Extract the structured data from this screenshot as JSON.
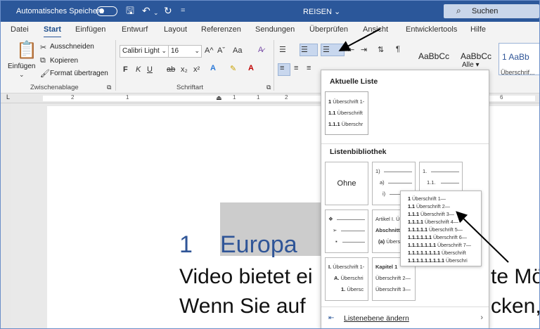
{
  "titlebar": {
    "autosave_label": "Automatisches Speichern",
    "doc_title": "REISEN",
    "title_chevron": "⌄",
    "search_label": "Suchen"
  },
  "tabs": [
    "Datei",
    "Start",
    "Einfügen",
    "Entwurf",
    "Layout",
    "Referenzen",
    "Sendungen",
    "Überprüfen",
    "Ansicht",
    "Entwicklertools",
    "Hilfe"
  ],
  "clipboard": {
    "paste": "Einfügen",
    "cut": "Ausschneiden",
    "copy": "Kopieren",
    "format_painter": "Format übertragen",
    "group_label": "Zwischenablage"
  },
  "font": {
    "name": "Calibri Light",
    "size": "16",
    "group_label": "Schriftart",
    "bold": "F",
    "italic": "K",
    "underline": "U",
    "strike": "ab",
    "sub": "x₂",
    "sup": "x²",
    "grow": "A^",
    "shrink": "Aˇ",
    "case": "Aa"
  },
  "styles": {
    "items": [
      "AaBbCc",
      "AaBbCc",
      "1 AaBb"
    ],
    "all_label": "Alle",
    "third_caption": "Überschrif..."
  },
  "document": {
    "heading_number": "1",
    "heading_text": "Europa",
    "line1_start": "Video bietet ei",
    "line1_end": "te Mö",
    "line2_start": "Wenn Sie auf",
    "line2_end": "cken,"
  },
  "ruler": {
    "numbers": [
      "2",
      "1",
      "1",
      "1",
      "2",
      "6"
    ]
  },
  "dropdown": {
    "current_list_header": "Aktuelle Liste",
    "current_list": [
      {
        "num": "1",
        "text": "Überschrift 1-"
      },
      {
        "num": "1.1",
        "text": "Überschrift"
      },
      {
        "num": "1.1.1",
        "text": "Überschr"
      }
    ],
    "library_header": "Listenbibliothek",
    "none_label": "Ohne",
    "tile2": {
      "l1": "1)",
      "l2": "a)",
      "l3": "i)"
    },
    "tile3": {
      "l1": "1.",
      "l2": "1.1."
    },
    "tile4": {
      "l1": "❖",
      "l2": "➢",
      "l3": "▪"
    },
    "tile5": {
      "l1": "Artikel I. Ü",
      "l2": "Abschnitt",
      "l3a": "(a)",
      "l3b": "Übers"
    },
    "tile7": {
      "l1a": "I.",
      "l1b": "Überschrift 1-",
      "l2a": "A.",
      "l2b": "Überschri",
      "l3a": "1.",
      "l3b": "Übersc"
    },
    "tile8": {
      "l1": "Kapitel 1",
      "l2": "Überschrift 2—",
      "l3": "Überschrift 3—"
    },
    "footer_label": "Listenebene ändern"
  },
  "preview": {
    "lines": [
      {
        "num": "1",
        "text": "Überschrift 1—"
      },
      {
        "num": "1.1",
        "text": "Überschrift 2—"
      },
      {
        "num": "1.1.1",
        "text": "Überschrift 3—"
      },
      {
        "num": "1.1.1.1",
        "text": "Überschrift 4—"
      },
      {
        "num": "1.1.1.1.1",
        "text": "Überschrift 5—"
      },
      {
        "num": "1.1.1.1.1.1",
        "text": "Überschrift 6—"
      },
      {
        "num": "1.1.1.1.1.1.1",
        "text": "Überschrift 7—"
      },
      {
        "num": "1.1.1.1.1.1.1.1",
        "text": "Überschrift"
      },
      {
        "num": "1.1.1.1.1.1.1.1.1",
        "text": "Überschri"
      }
    ]
  },
  "colors": {
    "title_bar": "#2b579a",
    "heading": "#2f5597",
    "highlight": "#c8d7ee"
  }
}
